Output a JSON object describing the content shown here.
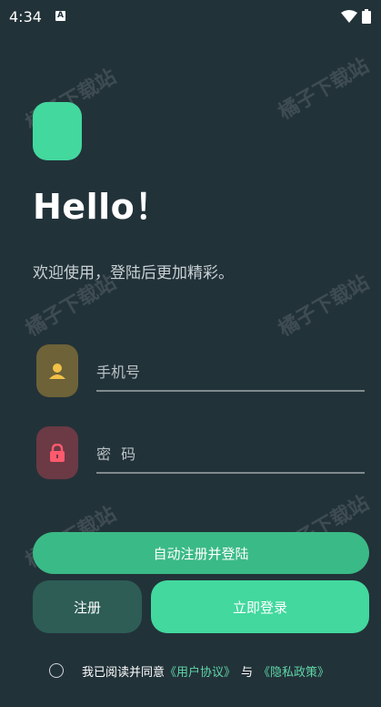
{
  "status_bar": {
    "time": "4:34",
    "notification_badge": "A"
  },
  "watermark_text": "橘子下载站",
  "hello": "Hello！",
  "welcome": "欢迎使用，登陆后更加精彩。",
  "phone_field": {
    "placeholder": "手机号",
    "value": ""
  },
  "password_field": {
    "placeholder": "密 码",
    "value": ""
  },
  "buttons": {
    "auto_register": "自动注册并登陆",
    "register": "注册",
    "login": "立即登录"
  },
  "agreement": {
    "prefix": "我已阅读并同意",
    "user_agreement": "《用户协议》",
    "and": "与",
    "privacy_policy": "《隐私政策》",
    "checked": false
  },
  "colors": {
    "background": "#223239",
    "accent": "#42d89e",
    "link": "#5fd6a8"
  },
  "icons": {
    "phone_field": "person-icon",
    "password_field": "lock-icon"
  }
}
